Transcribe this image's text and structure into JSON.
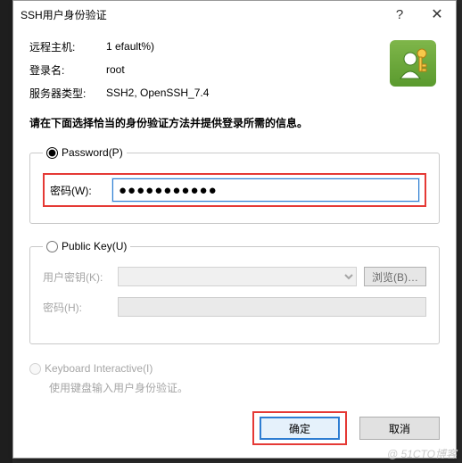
{
  "title": "SSH用户身份验证",
  "info": {
    "host_label": "远程主机:",
    "host_value": "1                           efault%)",
    "login_label": "登录名:",
    "login_value": "root",
    "server_label": "服务器类型:",
    "server_value": "SSH2, OpenSSH_7.4"
  },
  "instruction": "请在下面选择恰当的身份验证方法并提供登录所需的信息。",
  "pw": {
    "legend": "Password(P)",
    "label": "密码(W):",
    "value": "●●●●●●●●●●●"
  },
  "pk": {
    "legend": "Public Key(U)",
    "key_label": "用户密钥(K):",
    "browse": "浏览(B)…",
    "pw_label": "密码(H):"
  },
  "kb": {
    "legend": "Keyboard Interactive(I)",
    "desc": "使用键盘输入用户身份验证。"
  },
  "buttons": {
    "ok": "确定",
    "cancel": "取消"
  },
  "watermark": "@ 51CTO博客"
}
